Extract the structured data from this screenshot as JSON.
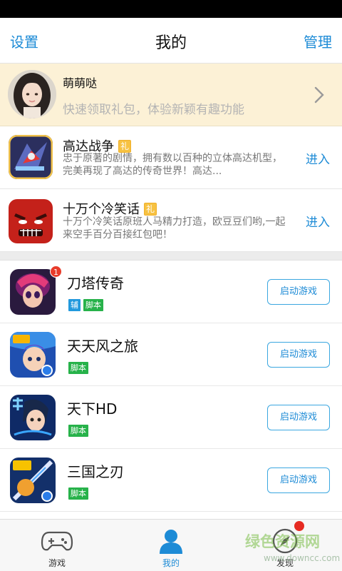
{
  "header": {
    "settings_label": "设置",
    "title": "我的",
    "manage_label": "管理"
  },
  "profile": {
    "name": "萌萌哒",
    "subtitle": "快速领取礼包，体验新颖有趣功能"
  },
  "featured": [
    {
      "name": "高达战争",
      "gift_label": "礼",
      "desc": "忠于原著的剧情，拥有数以百种的立体高达机型，完美再现了高达的传奇世界！高达...",
      "enter_label": "进入"
    },
    {
      "name": "十万个冷笑话",
      "gift_label": "礼",
      "desc": "十万个冷笑话原班人马精力打造，欧豆豆们哟,一起来空手百分百接红包吧！",
      "enter_label": "进入"
    }
  ],
  "launch_games": [
    {
      "name": "刀塔传奇",
      "badge": "1",
      "tags": [
        "辅",
        "脚本"
      ],
      "button": "启动游戏"
    },
    {
      "name": "天天风之旅",
      "tags": [
        "脚本"
      ],
      "button": "启动游戏"
    },
    {
      "name": "天下HD",
      "tags": [
        "脚本"
      ],
      "button": "启动游戏"
    },
    {
      "name": "三国之刃",
      "tags": [
        "脚本"
      ],
      "button": "启动游戏"
    }
  ],
  "tabs": [
    {
      "label": "游戏",
      "icon": "gamepad-icon"
    },
    {
      "label": "我的",
      "icon": "person-icon",
      "active": true
    },
    {
      "label": "发现",
      "icon": "compass-icon",
      "has_notification": true
    }
  ],
  "watermark": {
    "line1": "绿色资源网",
    "line2": "www.downcc.com"
  },
  "colors": {
    "accent": "#1d8bd6",
    "profile_bg": "#fcf1d6",
    "tag_green": "#27b24a",
    "tag_blue": "#2299dd",
    "badge_red": "#e83b2a"
  }
}
